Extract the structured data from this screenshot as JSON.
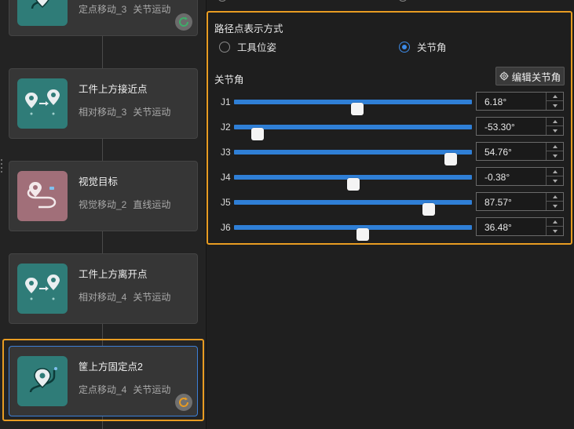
{
  "flow": {
    "cards": [
      {
        "title": "",
        "move": "定点移动_3",
        "motion": "关节运动",
        "icon": "pin-route-icon",
        "status": "refresh",
        "selected": false
      },
      {
        "title": "工件上方接近点",
        "move": "相对移动_3",
        "motion": "关节运动",
        "icon": "relative-move-icon",
        "status": "",
        "selected": false
      },
      {
        "title": "视觉目标",
        "move": "视觉移动_2",
        "motion": "直线运动",
        "icon": "vision-move-icon",
        "status": "",
        "selected": false
      },
      {
        "title": "工件上方离开点",
        "move": "相对移动_4",
        "motion": "关节运动",
        "icon": "relative-move-icon",
        "status": "",
        "selected": false
      },
      {
        "title": "筐上方固定点2",
        "move": "定点移动_4",
        "motion": "关节运动",
        "icon": "pin-route-icon",
        "status": "refresh-pending",
        "selected": true
      }
    ]
  },
  "panel": {
    "group_title": "路径点表示方式",
    "options": [
      {
        "label": "工具位姿",
        "checked": false
      },
      {
        "label": "关节角",
        "checked": true
      }
    ],
    "joint_section_label": "关节角",
    "edit_button": "编辑关节角",
    "joints": [
      {
        "name": "J1",
        "value": "6.18°",
        "fraction": 0.517
      },
      {
        "name": "J2",
        "value": "-53.30°",
        "fraction": 0.1
      },
      {
        "name": "J3",
        "value": "54.76°",
        "fraction": 0.91
      },
      {
        "name": "J4",
        "value": "-0.38°",
        "fraction": 0.5
      },
      {
        "name": "J5",
        "value": "87.57°",
        "fraction": 0.817
      },
      {
        "name": "J6",
        "value": "36.48°",
        "fraction": 0.54
      }
    ]
  },
  "colors": {
    "accent": "#2f7fd6",
    "highlight": "#e89c22",
    "tile_teal": "#2f7c78",
    "tile_pink": "#a16f79"
  }
}
